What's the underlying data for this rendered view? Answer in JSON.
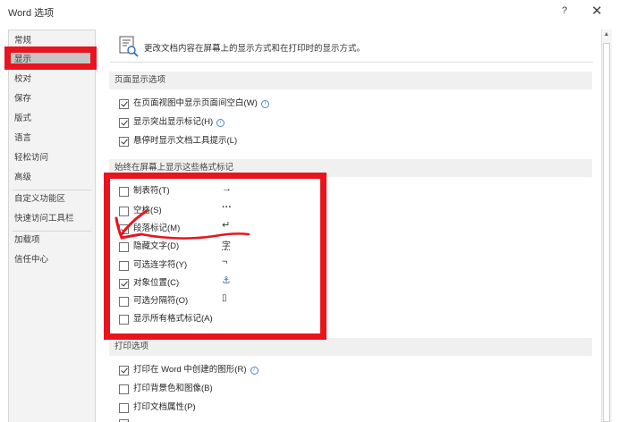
{
  "window": {
    "title": "Word 选项",
    "help": "?",
    "close": "✕"
  },
  "sidebar": {
    "items": [
      {
        "label": "常规"
      },
      {
        "label": "显示"
      },
      {
        "label": "校对"
      },
      {
        "label": "保存"
      },
      {
        "label": "版式"
      },
      {
        "label": "语言"
      },
      {
        "label": "轻松访问"
      },
      {
        "label": "高级"
      },
      {
        "label": "自定义功能区"
      },
      {
        "label": "快速访问工具栏"
      },
      {
        "label": "加载项"
      },
      {
        "label": "信任中心"
      }
    ],
    "active": "显示"
  },
  "intro": {
    "text": "更改文档内容在屏幕上的显示方式和在打印时的显示方式。"
  },
  "page_display": {
    "heading": "页面显示选项",
    "options": [
      {
        "label": "在页面视图中显示页面间空白(W)",
        "checked": true,
        "info": true
      },
      {
        "label": "显示突出显示标记(H)",
        "checked": true,
        "info": true
      },
      {
        "label": "悬停时显示文档工具提示(L)",
        "checked": true,
        "info": false
      }
    ]
  },
  "format_marks": {
    "heading": "始终在屏幕上显示这些格式标记",
    "options": [
      {
        "label": "制表符(T)",
        "checked": false,
        "symbol": "→"
      },
      {
        "label": "空格(S)",
        "checked": false,
        "symbol": "···"
      },
      {
        "label": "段落标记(M)",
        "checked": true,
        "symbol": "↵"
      },
      {
        "label": "隐藏文字(D)",
        "checked": false,
        "symbol": "字"
      },
      {
        "label": "可选连字符(Y)",
        "checked": false,
        "symbol": "¬"
      },
      {
        "label": "对象位置(C)",
        "checked": true,
        "symbol": "⚓"
      },
      {
        "label": "可选分隔符(O)",
        "checked": false,
        "symbol": "▯"
      },
      {
        "label": "显示所有格式标记(A)",
        "checked": false,
        "symbol": ""
      }
    ]
  },
  "print": {
    "heading": "打印选项",
    "options": [
      {
        "label": "打印在 Word 中创建的图形(R)",
        "checked": true,
        "info": true
      },
      {
        "label": "打印背景色和图像(B)",
        "checked": false,
        "info": false
      },
      {
        "label": "打印文档属性(P)",
        "checked": false,
        "info": false
      }
    ]
  },
  "colors": {
    "annotation": "#e8141e",
    "active_item": "#c6c6c6",
    "section_bg": "#f0f0f0"
  }
}
